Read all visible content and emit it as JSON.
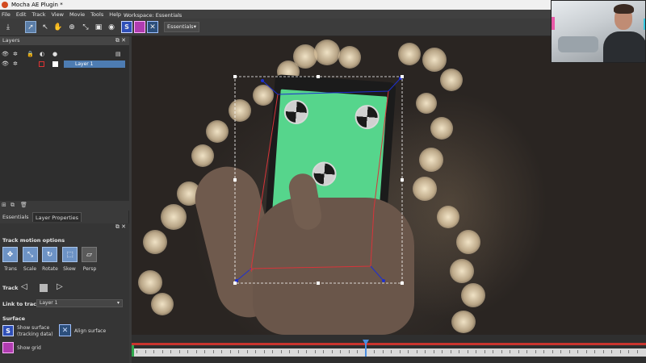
{
  "title": "Mocha AE Plugin *",
  "menu": [
    "File",
    "Edit",
    "Track",
    "View",
    "Movie",
    "Tools",
    "Help"
  ],
  "workspace": {
    "label": "Workspace: Essentials",
    "selected": "Essentials"
  },
  "toolbar_icons": [
    "save-icon",
    "select-icon",
    "add-point-icon",
    "hand-icon",
    "zoom-icon",
    "transform-icon",
    "stabilize-icon",
    "bezier-icon",
    "record-icon",
    "surface-s-icon",
    "grid-icon",
    "align-icon"
  ],
  "layers_panel": {
    "title": "Layers",
    "layers": [
      {
        "name": "Layer 1",
        "color": "#4d7cb2"
      }
    ]
  },
  "tabs": [
    "Essentials",
    "Layer Properties"
  ],
  "active_tab": "Layer Properties",
  "track_motion": {
    "title": "Track motion options",
    "options": [
      {
        "label": "Trans",
        "active": true
      },
      {
        "label": "Scale",
        "active": true
      },
      {
        "label": "Rotate",
        "active": true
      },
      {
        "label": "Skew",
        "active": true
      },
      {
        "label": "Persp",
        "active": false
      }
    ]
  },
  "track": {
    "label": "Track"
  },
  "link_to_track": {
    "label": "Link to track",
    "value": "Layer 1"
  },
  "surface": {
    "title": "Surface",
    "show_surface_line1": "Show surface",
    "show_surface_line2": "(tracking data)",
    "align_surface": "Align surface",
    "show_grid": "Show grid"
  },
  "colors": {
    "accent": "#5b7ea8",
    "layer_highlight": "#4d7cb2",
    "screen_green": "#56d58c",
    "timeline_red": "#c9352e",
    "playhead_blue": "#4a8de0",
    "spline_red": "#d8343a",
    "corner_blue": "#1e2fd0"
  },
  "timeline": {
    "playhead_fraction": 0.45
  }
}
